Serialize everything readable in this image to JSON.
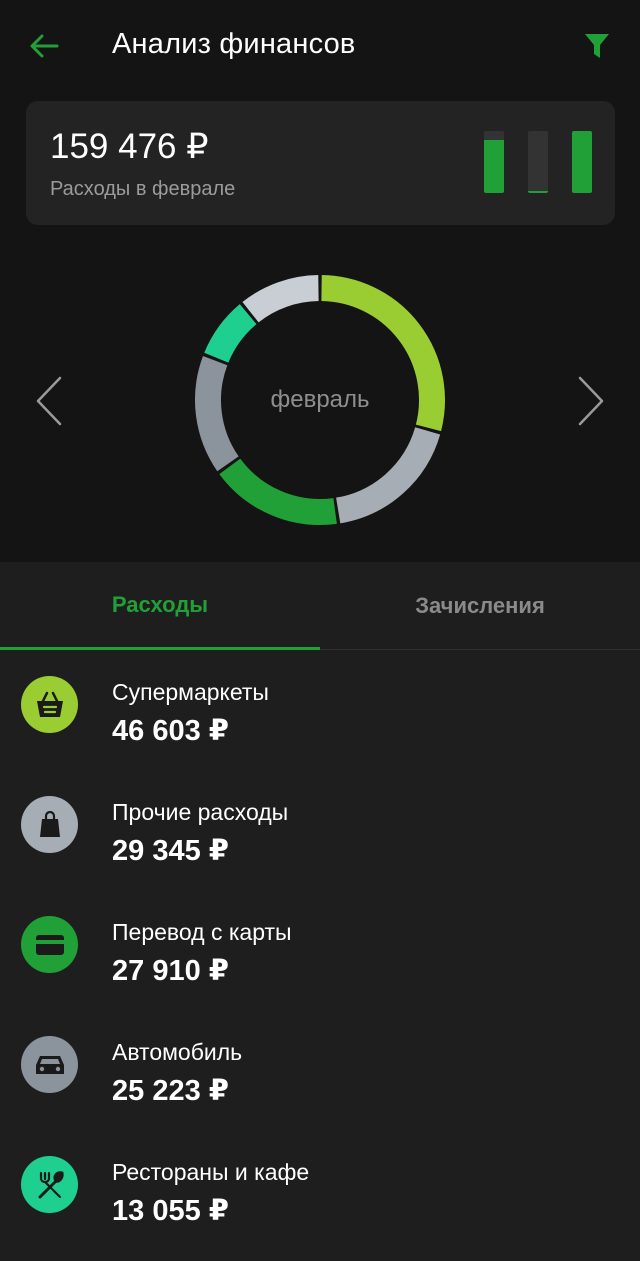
{
  "header": {
    "title": "Анализ финансов",
    "back_icon": "arrow-left-icon",
    "filter_icon": "filter-icon",
    "accent": "#21a038"
  },
  "summary": {
    "amount": "159 476 ₽",
    "label": "Расходы в феврале",
    "bars": [
      0.85,
      0.04,
      1.0
    ]
  },
  "donut": {
    "center_label": "февраль",
    "segments": [
      {
        "value": 46603,
        "color": "#9acd32"
      },
      {
        "value": 29345,
        "color": "#a7adb5"
      },
      {
        "value": 27910,
        "color": "#21a038"
      },
      {
        "value": 25223,
        "color": "#8b939c"
      },
      {
        "value": 13055,
        "color": "#1fcf8f"
      },
      {
        "value": 17340,
        "color": "#c9ced4"
      }
    ]
  },
  "tabs": {
    "active": "Расходы",
    "inactive": "Зачисления"
  },
  "categories": [
    {
      "name": "Супермаркеты",
      "amount": "46 603 ₽",
      "icon": "basket-icon",
      "color": "#9acd32"
    },
    {
      "name": "Прочие расходы",
      "amount": "29 345 ₽",
      "icon": "shopping-bag-icon",
      "color": "#a7adb5"
    },
    {
      "name": "Перевод с карты",
      "amount": "27 910 ₽",
      "icon": "card-icon",
      "color": "#21a038"
    },
    {
      "name": "Автомобиль",
      "amount": "25 223 ₽",
      "icon": "car-icon",
      "color": "#8b939c"
    },
    {
      "name": "Рестораны и кафе",
      "amount": "13 055 ₽",
      "icon": "fork-knife-icon",
      "color": "#1fcf8f"
    }
  ]
}
